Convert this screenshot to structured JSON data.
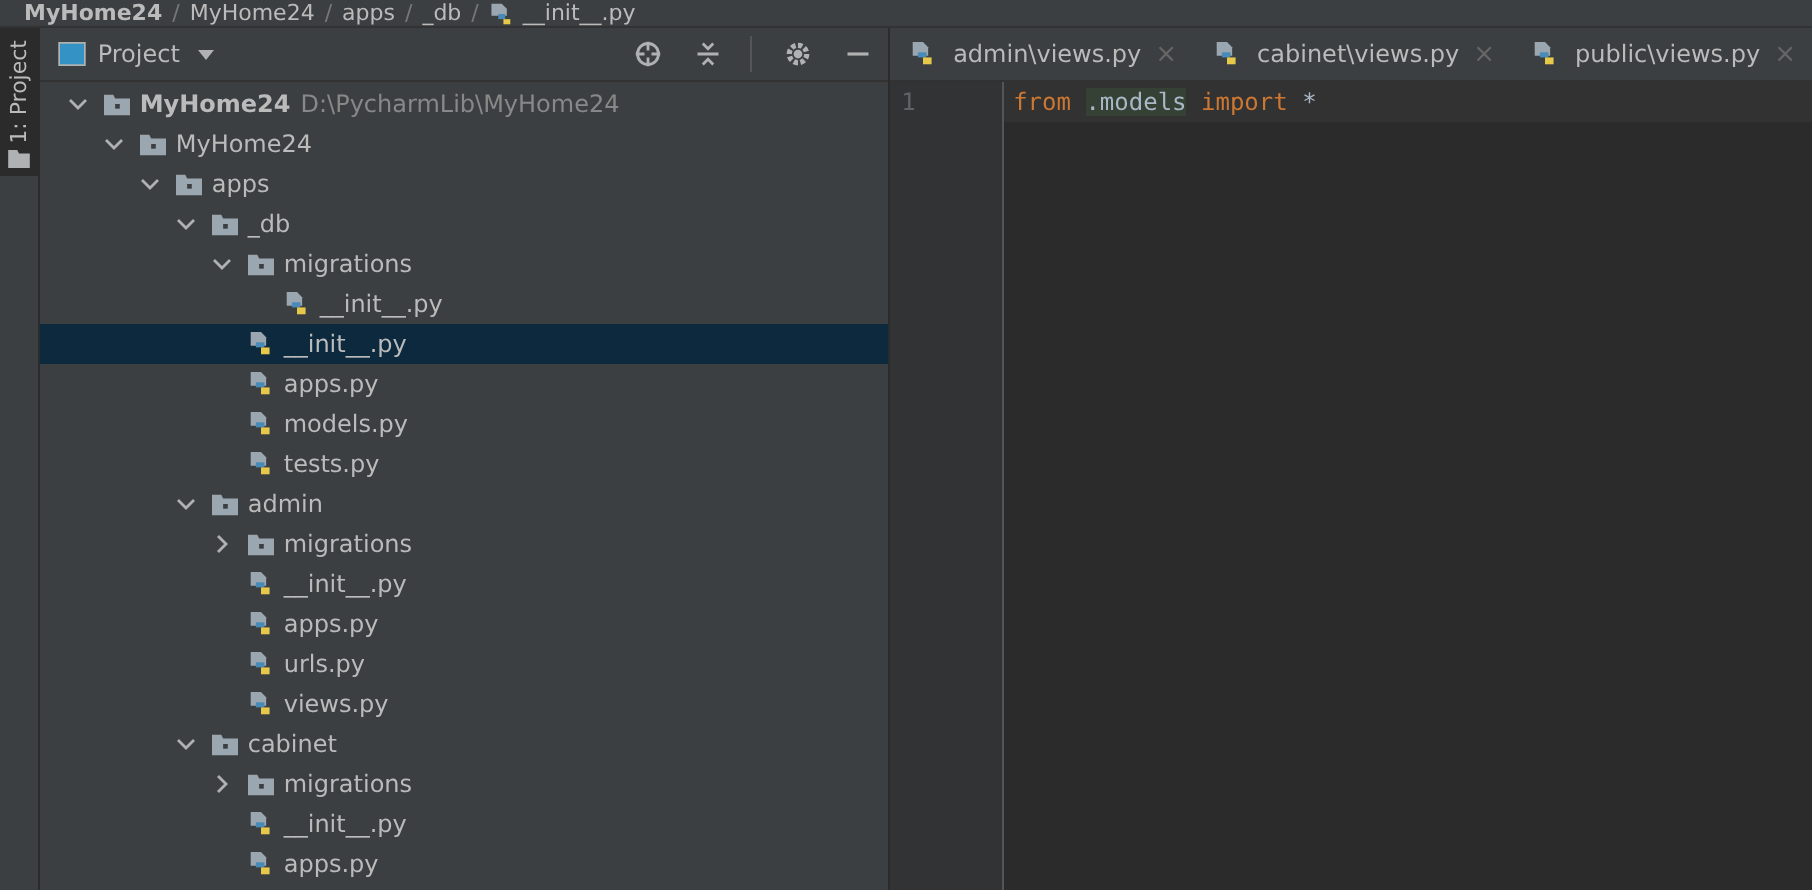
{
  "breadcrumbs": [
    {
      "label": "MyHome24",
      "kind": "bold"
    },
    {
      "label": "MyHome24",
      "kind": "folder",
      "separator": "/"
    },
    {
      "label": "apps",
      "kind": "folder",
      "separator": "/"
    },
    {
      "label": "_db",
      "kind": "folder",
      "separator": "/"
    },
    {
      "label": "__init__.py",
      "kind": "file",
      "separator": "/"
    }
  ],
  "side_strip": {
    "label": "1: Project"
  },
  "panel": {
    "title": "Project"
  },
  "tree": [
    {
      "label": "MyHome24",
      "path": "D:\\PycharmLib\\MyHome24",
      "kind": "folder",
      "expanded": true,
      "selected": false,
      "children": [
        {
          "label": "MyHome24",
          "kind": "folder",
          "expanded": true,
          "selected": false,
          "children": [
            {
              "label": "apps",
              "kind": "folder",
              "expanded": true,
              "selected": false,
              "children": [
                {
                  "label": "_db",
                  "kind": "folder",
                  "expanded": true,
                  "selected": false,
                  "children": [
                    {
                      "label": "migrations",
                      "kind": "folder",
                      "expanded": true,
                      "selected": false,
                      "children": [
                        {
                          "label": "__init__.py",
                          "kind": "file",
                          "selected": false
                        }
                      ]
                    },
                    {
                      "label": "__init__.py",
                      "kind": "file",
                      "selected": true
                    },
                    {
                      "label": "apps.py",
                      "kind": "file",
                      "selected": false
                    },
                    {
                      "label": "models.py",
                      "kind": "file",
                      "selected": false
                    },
                    {
                      "label": "tests.py",
                      "kind": "file",
                      "selected": false
                    }
                  ]
                },
                {
                  "label": "admin",
                  "kind": "folder",
                  "expanded": true,
                  "selected": false,
                  "children": [
                    {
                      "label": "migrations",
                      "kind": "folder",
                      "expanded": false,
                      "selected": false
                    },
                    {
                      "label": "__init__.py",
                      "kind": "file",
                      "selected": false
                    },
                    {
                      "label": "apps.py",
                      "kind": "file",
                      "selected": false
                    },
                    {
                      "label": "urls.py",
                      "kind": "file",
                      "selected": false
                    },
                    {
                      "label": "views.py",
                      "kind": "file",
                      "selected": false
                    }
                  ]
                },
                {
                  "label": "cabinet",
                  "kind": "folder",
                  "expanded": true,
                  "selected": false,
                  "children": [
                    {
                      "label": "migrations",
                      "kind": "folder",
                      "expanded": false,
                      "selected": false
                    },
                    {
                      "label": "__init__.py",
                      "kind": "file",
                      "selected": false
                    },
                    {
                      "label": "apps.py",
                      "kind": "file",
                      "selected": false
                    }
                  ]
                }
              ]
            }
          ]
        }
      ]
    }
  ],
  "tabs": [
    {
      "label": "admin\\views.py",
      "close": "×",
      "selected": false
    },
    {
      "label": "cabinet\\views.py",
      "close": "×",
      "selected": false
    },
    {
      "label": "public\\views.py",
      "close": "×",
      "selected": false
    }
  ],
  "editor": {
    "lines": [
      {
        "number": "1",
        "tokens": [
          {
            "text": "from",
            "kind": "keyword"
          },
          {
            "text": ".models",
            "kind": "highlight"
          },
          {
            "text": "import",
            "kind": "keyword"
          },
          {
            "text": "*",
            "kind": "plain"
          }
        ]
      }
    ]
  }
}
